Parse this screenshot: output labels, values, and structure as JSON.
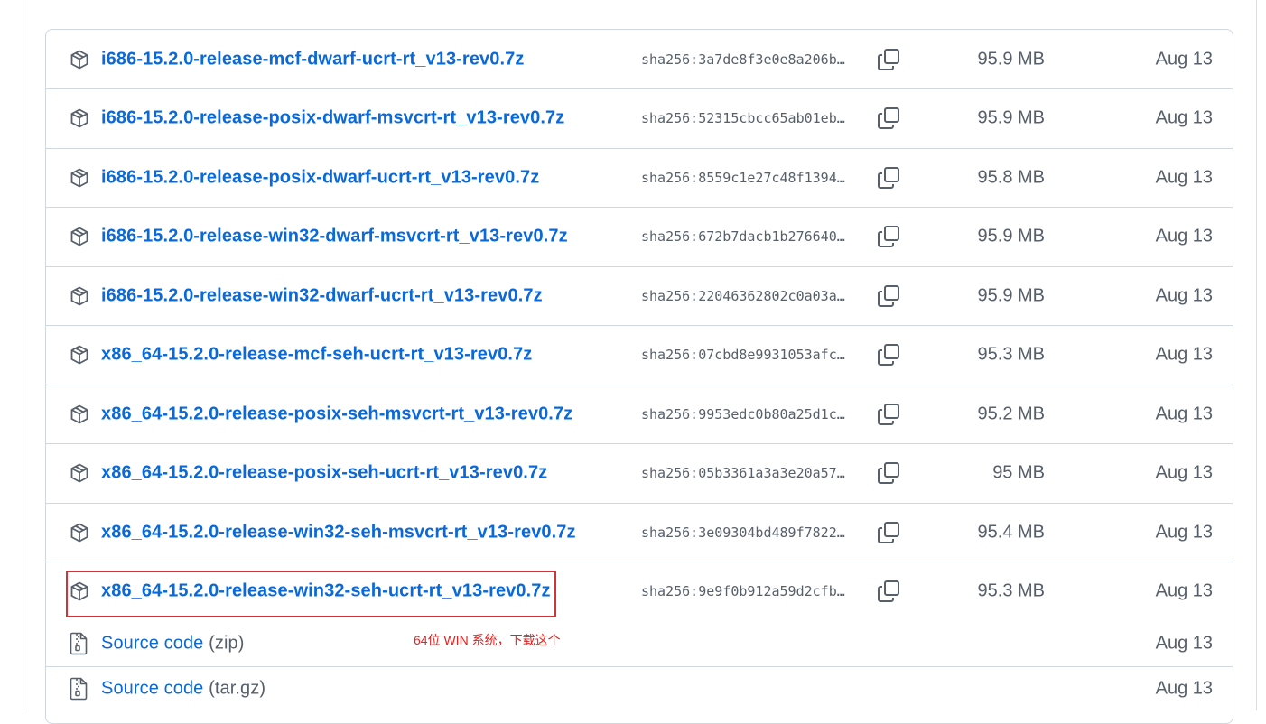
{
  "assets": [
    {
      "name": "i686-15.2.0-release-mcf-dwarf-ucrt-rt_v13-rev0.7z",
      "digest": "sha256:3a7de8f3e0e8a206b…",
      "size": "95.9 MB",
      "date": "Aug 13"
    },
    {
      "name": "i686-15.2.0-release-posix-dwarf-msvcrt-rt_v13-rev0.7z",
      "digest": "sha256:52315cbcc65ab01eb…",
      "size": "95.9 MB",
      "date": "Aug 13"
    },
    {
      "name": "i686-15.2.0-release-posix-dwarf-ucrt-rt_v13-rev0.7z",
      "digest": "sha256:8559c1e27c48f1394…",
      "size": "95.8 MB",
      "date": "Aug 13"
    },
    {
      "name": "i686-15.2.0-release-win32-dwarf-msvcrt-rt_v13-rev0.7z",
      "digest": "sha256:672b7dacb1b276640…",
      "size": "95.9 MB",
      "date": "Aug 13"
    },
    {
      "name": "i686-15.2.0-release-win32-dwarf-ucrt-rt_v13-rev0.7z",
      "digest": "sha256:22046362802c0a03a…",
      "size": "95.9 MB",
      "date": "Aug 13"
    },
    {
      "name": "x86_64-15.2.0-release-mcf-seh-ucrt-rt_v13-rev0.7z",
      "digest": "sha256:07cbd8e9931053afc…",
      "size": "95.3 MB",
      "date": "Aug 13"
    },
    {
      "name": "x86_64-15.2.0-release-posix-seh-msvcrt-rt_v13-rev0.7z",
      "digest": "sha256:9953edc0b80a25d1c…",
      "size": "95.2 MB",
      "date": "Aug 13"
    },
    {
      "name": "x86_64-15.2.0-release-posix-seh-ucrt-rt_v13-rev0.7z",
      "digest": "sha256:05b3361a3a3e20a57…",
      "size": "95 MB",
      "date": "Aug 13"
    },
    {
      "name": "x86_64-15.2.0-release-win32-seh-msvcrt-rt_v13-rev0.7z",
      "digest": "sha256:3e09304bd489f7822…",
      "size": "95.4 MB",
      "date": "Aug 13"
    },
    {
      "name": "x86_64-15.2.0-release-win32-seh-ucrt-rt_v13-rev0.7z",
      "digest": "sha256:9e9f0b912a59d2cfb…",
      "size": "95.3 MB",
      "date": "Aug 13"
    }
  ],
  "source": [
    {
      "label": "Source code",
      "format": "(zip)",
      "date": "Aug 13"
    },
    {
      "label": "Source code",
      "format": "(tar.gz)",
      "date": "Aug 13"
    }
  ],
  "annotation": {
    "text": "64位 WIN 系统，下载这个",
    "color": "#e02424"
  },
  "colors": {
    "link": "#0969da",
    "muted": "#57606a",
    "border": "#d0d7de",
    "highlight": "#d13438"
  },
  "icons": {
    "asset": "package-icon",
    "copy": "copy-icon",
    "source": "file-zip-icon"
  }
}
